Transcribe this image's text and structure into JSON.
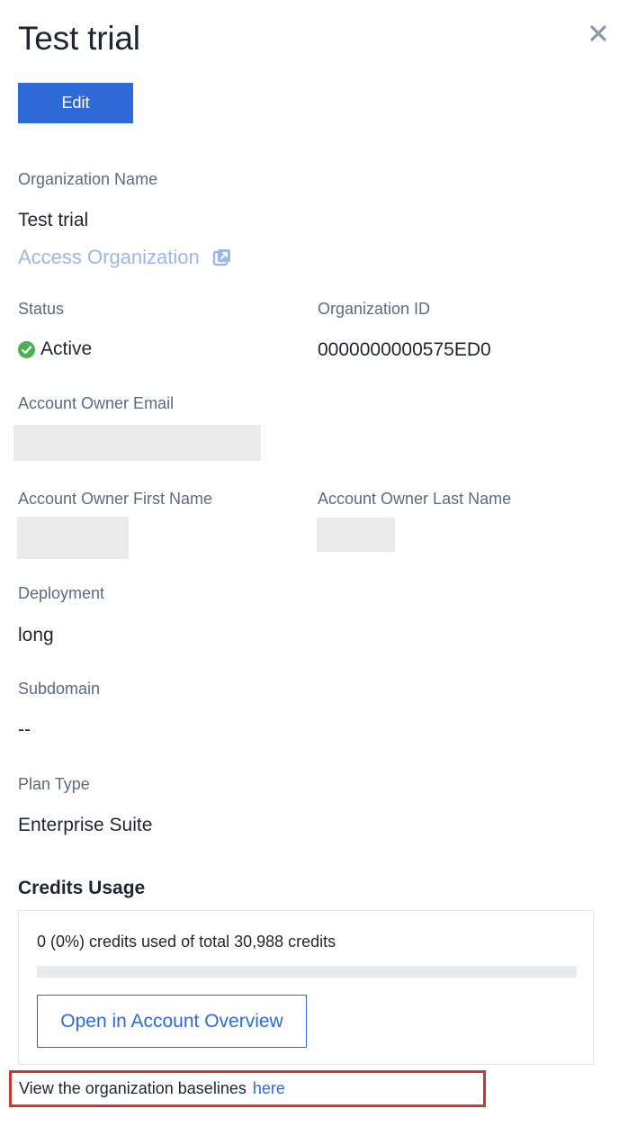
{
  "header": {
    "title": "Test trial",
    "edit_label": "Edit"
  },
  "organization": {
    "name_label": "Organization Name",
    "name_value": "Test trial",
    "access_link": "Access Organization",
    "status_label": "Status",
    "status_value": "Active",
    "id_label": "Organization ID",
    "id_value": "0000000000575ED0",
    "owner_email_label": "Account Owner Email",
    "owner_first_label": "Account Owner First Name",
    "owner_last_label": "Account Owner Last Name",
    "deployment_label": "Deployment",
    "deployment_value": "long",
    "subdomain_label": "Subdomain",
    "subdomain_value": "--",
    "plan_label": "Plan Type",
    "plan_value": "Enterprise Suite"
  },
  "credits": {
    "title": "Credits Usage",
    "summary": "0 (0%) credits used of total 30,988 credits",
    "used_fraction": 0,
    "open_button": "Open in Account Overview"
  },
  "baselines": {
    "text": "View the organization baselines",
    "link": "here"
  },
  "colors": {
    "primary": "#2d69d7",
    "success": "#4caf50",
    "highlight_border": "#c8392e"
  },
  "icons": {
    "close": "close-icon",
    "external": "external-link-icon",
    "status": "check-circle-icon"
  }
}
